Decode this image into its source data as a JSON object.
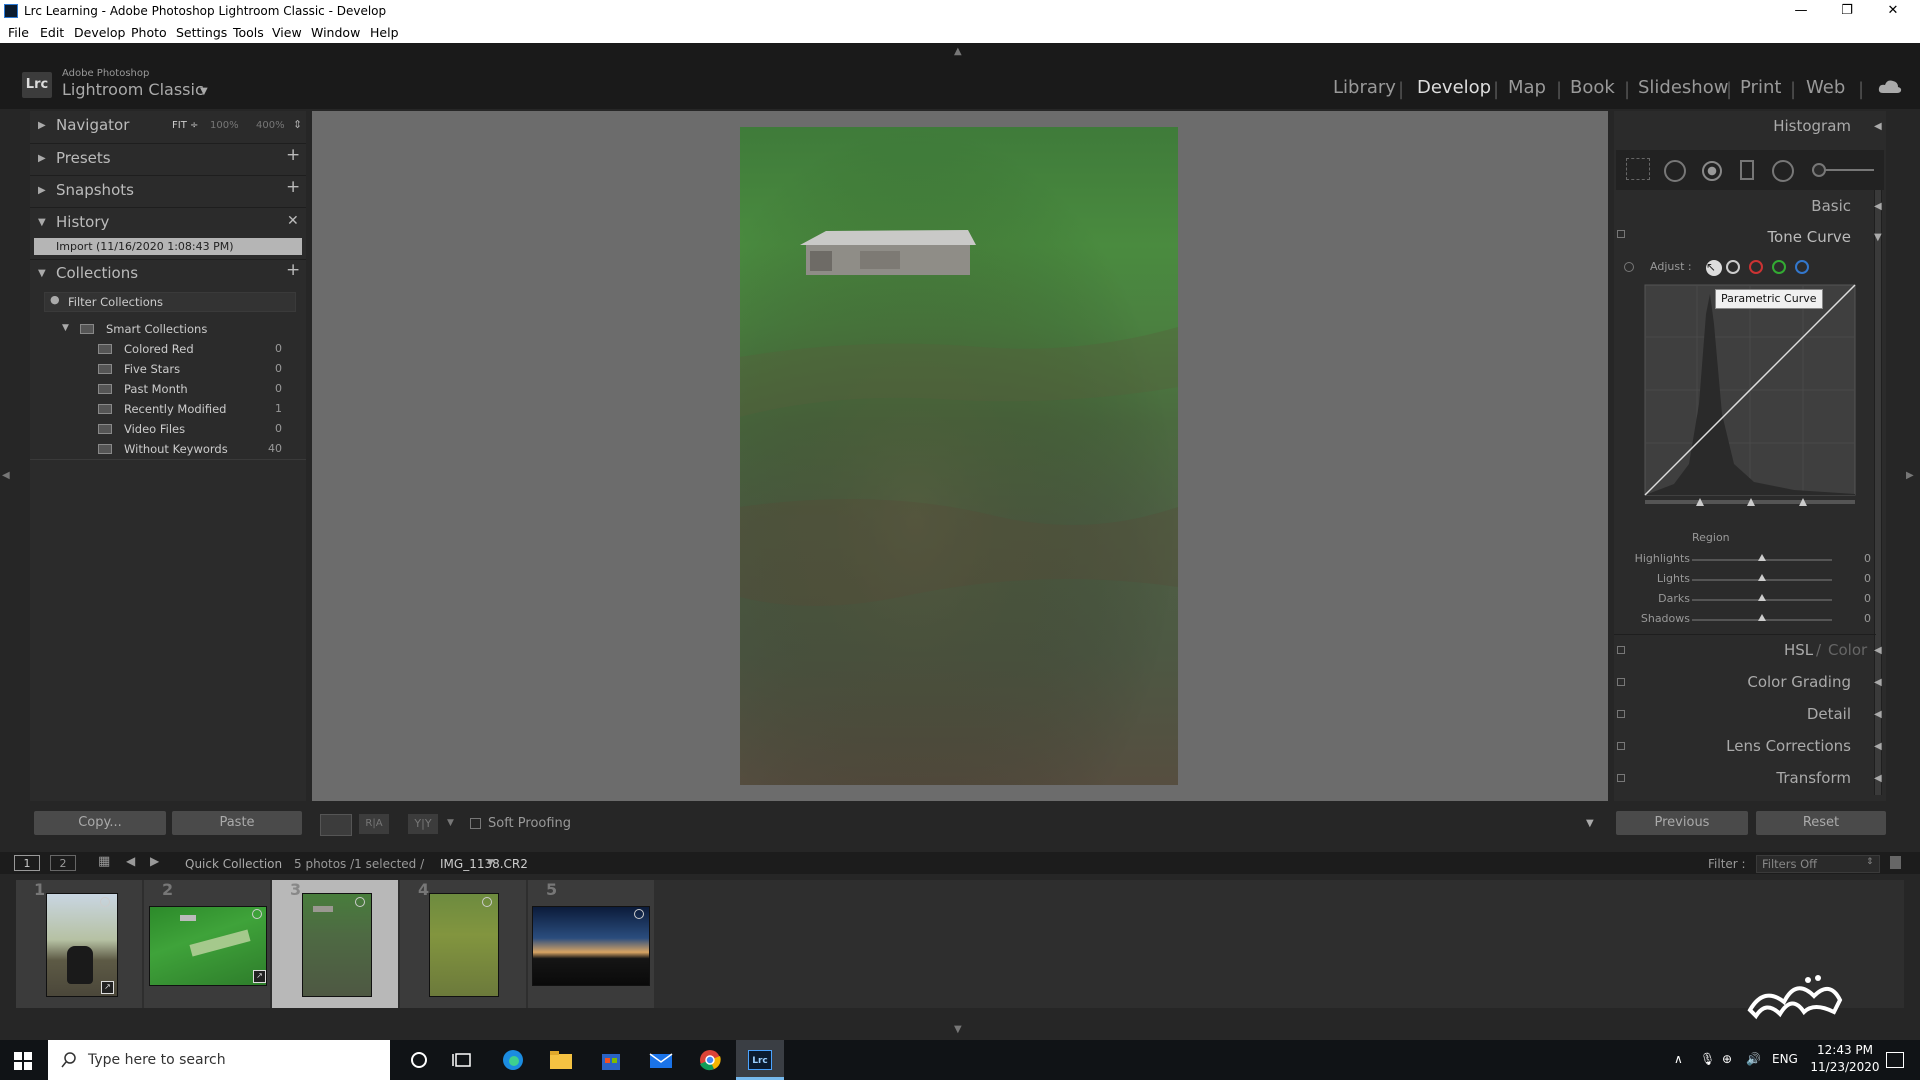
{
  "window": {
    "title": "Lrc Learning - Adobe Photoshop Lightroom Classic - Develop",
    "controls": [
      "—",
      "❐",
      "✕"
    ]
  },
  "menu": [
    "File",
    "Edit",
    "Develop",
    "Photo",
    "Settings",
    "Tools",
    "View",
    "Window",
    "Help"
  ],
  "identity": {
    "logo": "Lrc",
    "brand_top": "Adobe Photoshop",
    "brand_main": "Lightroom Classic",
    "modules": [
      "Library",
      "Develop",
      "Map",
      "Book",
      "Slideshow",
      "Print",
      "Web"
    ],
    "active_module": "Develop"
  },
  "left": {
    "navigator": {
      "title": "Navigator",
      "zoom": [
        "FIT ÷",
        "100%",
        "400%"
      ]
    },
    "presets": "Presets",
    "snapshots": "Snapshots",
    "history": {
      "title": "History",
      "items": [
        "Import (11/16/2020 1:08:43 PM)"
      ]
    },
    "collections": {
      "title": "Collections",
      "filter": "Filter Collections",
      "group": "Smart Collections",
      "items": [
        {
          "name": "Colored Red",
          "count": "0"
        },
        {
          "name": "Five Stars",
          "count": "0"
        },
        {
          "name": "Past Month",
          "count": "0"
        },
        {
          "name": "Recently Modified",
          "count": "1"
        },
        {
          "name": "Video Files",
          "count": "0"
        },
        {
          "name": "Without Keywords",
          "count": "40"
        }
      ]
    },
    "copy": "Copy...",
    "paste": "Paste"
  },
  "toolbar": {
    "soft_proofing": "Soft Proofing"
  },
  "right": {
    "histogram": "Histogram",
    "basic": "Basic",
    "tone_curve": "Tone Curve",
    "adjust": "Adjust :",
    "tooltip": "Parametric Curve",
    "region": "Region",
    "sliders": [
      {
        "label": "Highlights",
        "value": "0"
      },
      {
        "label": "Lights",
        "value": "0"
      },
      {
        "label": "Darks",
        "value": "0"
      },
      {
        "label": "Shadows",
        "value": "0"
      }
    ],
    "hsl": "HSL",
    "hsl_sep": "/",
    "color": "Color",
    "color_grading": "Color Grading",
    "detail": "Detail",
    "lens": "Lens Corrections",
    "transform": "Transform",
    "previous": "Previous",
    "reset": "Reset"
  },
  "filmbar": {
    "views": [
      "1",
      "2"
    ],
    "source": "Quick Collection",
    "info": "5 photos /1 selected /",
    "filename": "IMG_1138.CR2",
    "filter_label": "Filter :",
    "filter_value": "Filters Off"
  },
  "filmstrip": {
    "numbers": [
      "1",
      "2",
      "3",
      "4",
      "5"
    ],
    "selected": "3"
  },
  "taskbar": {
    "search": "Type here to search",
    "lang": "ENG",
    "time": "12:43 PM",
    "date": "11/23/2020"
  }
}
